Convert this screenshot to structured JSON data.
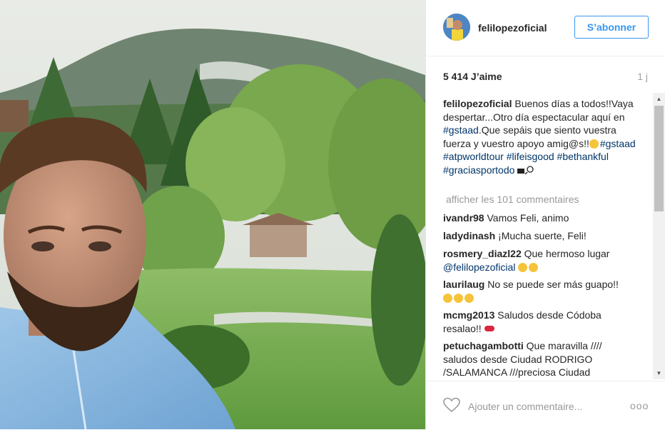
{
  "post": {
    "username": "felilopezoficial",
    "follow_label": "S’abonner",
    "likes": "5 414 J’aime",
    "time": "1 j",
    "caption": {
      "username": "felilopezoficial",
      "text_1": "Buenos días a todos!!Vaya despertar...Otro día espectacular aquí en",
      "tag_1": "#gstaad",
      "text_2": ".Que sepáis que siento vuestra fuerza y vuestro apoyo amig@s!!",
      "tag_2": "#gstaad",
      "tag_3": "#atpworldtour",
      "tag_4": "#lifeisgood",
      "tag_5": "#bethankful",
      "tag_6": "#graciasportodo"
    },
    "more_comments": "afficher les 101 commentaires",
    "comments": [
      {
        "user": "ivandr98",
        "text": "Vamos Feli, animo"
      },
      {
        "user": "ladydinash",
        "text": "¡Mucha suerte, Feli!"
      },
      {
        "user": "rosmery_diazl22",
        "text": "Que hermoso lugar",
        "mention": "@felilopezoficial"
      },
      {
        "user": "laurilaug",
        "text": "No se puede ser más guapo!!"
      },
      {
        "user": "mcmg2013",
        "text": "Saludos desde Códoba resalao!!"
      },
      {
        "user": "petuchagambotti",
        "text": "Que maravilla //// saludos desde Ciudad RODRIGO /SALAMANCA ///preciosa Ciudad"
      }
    ],
    "comment_placeholder": "Ajouter un commentaire...",
    "more_options": "ooo"
  },
  "icons": {
    "heart": "heart-icon",
    "options": "more-options-icon",
    "avatar": "avatar"
  },
  "colors": {
    "accent": "#3897f0",
    "hashtag": "#003569"
  }
}
